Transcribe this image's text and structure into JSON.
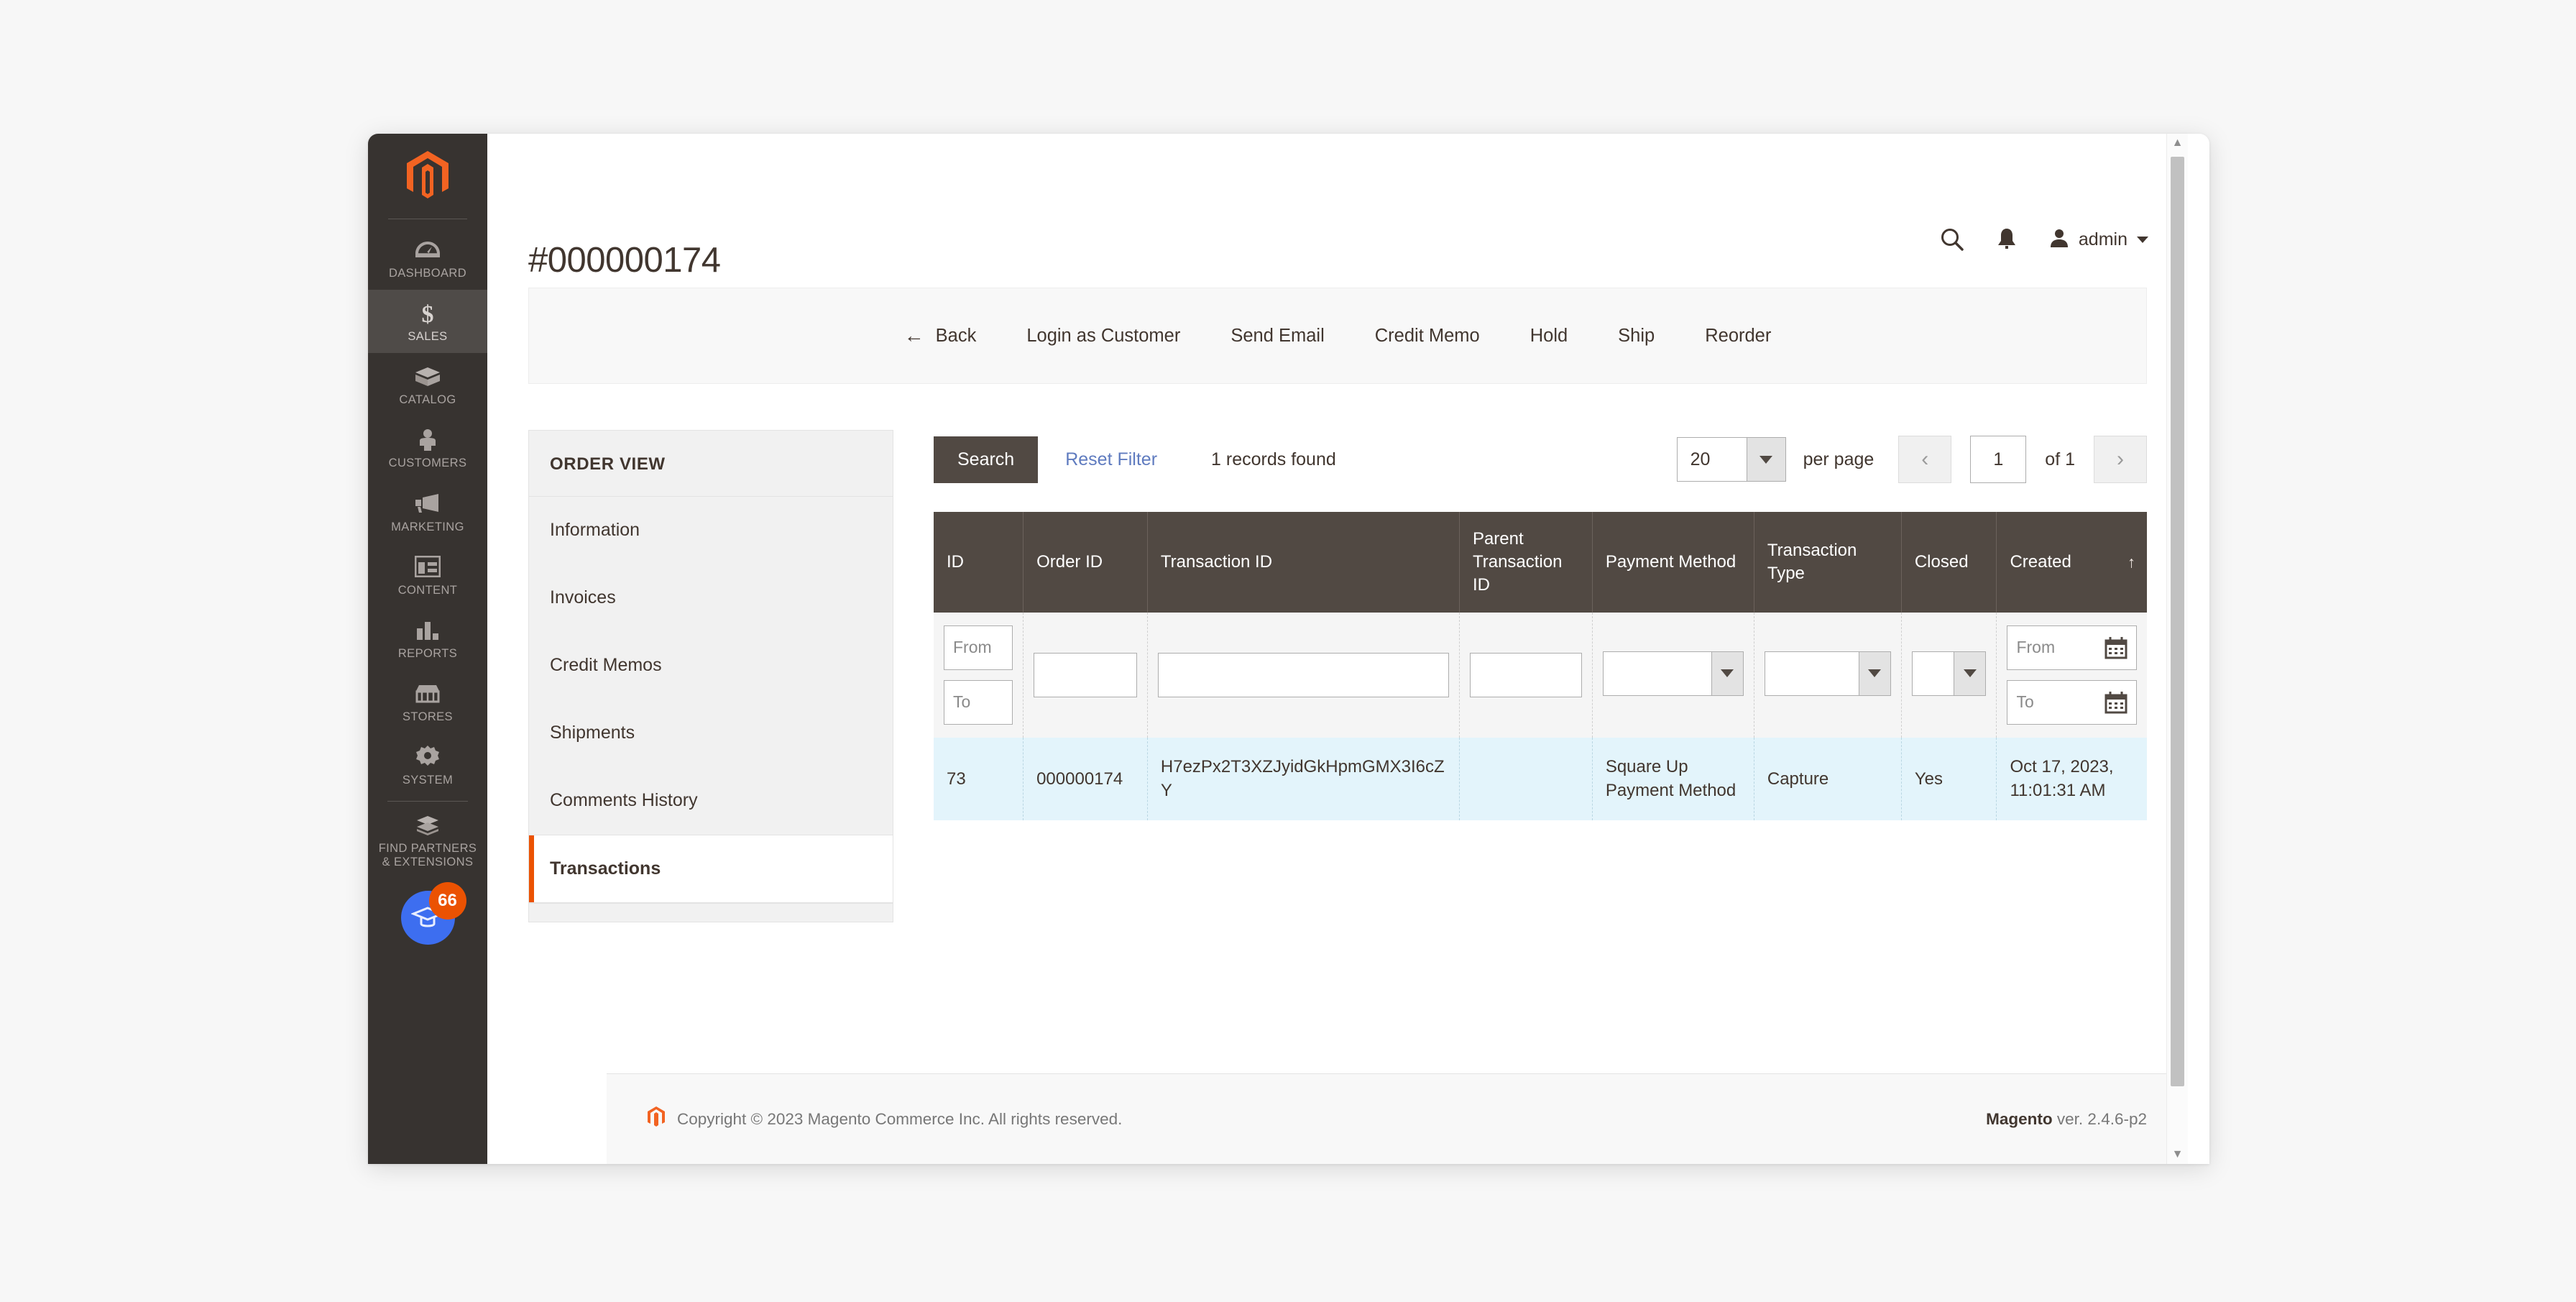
{
  "sidebar": {
    "logo": "magento-logo",
    "items": [
      {
        "label": "DASHBOARD",
        "icon": "gauge-icon",
        "active": false
      },
      {
        "label": "SALES",
        "icon": "dollar-icon",
        "active": true
      },
      {
        "label": "CATALOG",
        "icon": "box-icon",
        "active": false
      },
      {
        "label": "CUSTOMERS",
        "icon": "person-icon",
        "active": false
      },
      {
        "label": "MARKETING",
        "icon": "megaphone-icon",
        "active": false
      },
      {
        "label": "CONTENT",
        "icon": "layout-icon",
        "active": false
      },
      {
        "label": "REPORTS",
        "icon": "bar-chart-icon",
        "active": false
      },
      {
        "label": "STORES",
        "icon": "storefront-icon",
        "active": false
      },
      {
        "label": "SYSTEM",
        "icon": "gear-icon",
        "active": false
      },
      {
        "label": "FIND PARTNERS\n& EXTENSIONS",
        "icon": "extensions-icon",
        "active": false
      }
    ],
    "learn_badge": {
      "icon": "graduation-cap-icon",
      "count": "66",
      "circle_color": "#3d6ef0",
      "badge_color": "#eb5202"
    }
  },
  "header": {
    "page_title": "#000000174",
    "search_icon": "search-icon",
    "notifications_icon": "bell-icon",
    "user_icon": "user-avatar-icon",
    "user_name": "admin"
  },
  "action_toolbar": {
    "back_label": "Back",
    "back_arrow": "←",
    "buttons": [
      "Login as Customer",
      "Send Email",
      "Credit Memo",
      "Hold",
      "Ship",
      "Reorder"
    ]
  },
  "order_view": {
    "title": "ORDER VIEW",
    "items": [
      {
        "label": "Information",
        "current": false
      },
      {
        "label": "Invoices",
        "current": false
      },
      {
        "label": "Credit Memos",
        "current": false
      },
      {
        "label": "Shipments",
        "current": false
      },
      {
        "label": "Comments History",
        "current": false
      },
      {
        "label": "Transactions",
        "current": true
      }
    ],
    "active_accent": "#eb5202"
  },
  "grid_toolbar": {
    "search_label": "Search",
    "reset_filter_label": "Reset Filter",
    "records_found": "1 records found",
    "per_page_value": "20",
    "per_page_label": "per page",
    "prev_glyph": "‹",
    "next_glyph": "›",
    "page_value": "1",
    "of_label": "of 1"
  },
  "grid": {
    "columns": [
      {
        "key": "id",
        "label": "ID",
        "sorted": false
      },
      {
        "key": "order_id",
        "label": "Order ID",
        "sorted": false
      },
      {
        "key": "transaction_id",
        "label": "Transaction ID",
        "sorted": false
      },
      {
        "key": "parent_transaction_id",
        "label": "Parent Transaction ID",
        "sorted": false
      },
      {
        "key": "payment_method",
        "label": "Payment Method",
        "sorted": false
      },
      {
        "key": "transaction_type",
        "label": "Transaction Type",
        "sorted": false
      },
      {
        "key": "closed",
        "label": "Closed",
        "sorted": false
      },
      {
        "key": "created",
        "label": "Created",
        "sorted": true,
        "sort_arrow": "↑"
      }
    ],
    "filters": {
      "id_from_placeholder": "From",
      "id_to_placeholder": "To",
      "order_id_value": "",
      "transaction_id_value": "",
      "parent_transaction_id_value": "",
      "payment_method_value": "",
      "transaction_type_value": "",
      "closed_value": "",
      "created_from_placeholder": "From",
      "created_to_placeholder": "To",
      "calendar_icon": "calendar-icon"
    },
    "rows": [
      {
        "id": "73",
        "order_id": "000000174",
        "transaction_id": "H7ezPx2T3XZJyidGkHpmGMX3I6cZY",
        "parent_transaction_id": "",
        "payment_method": "Square Up Payment Method",
        "transaction_type": "Capture",
        "closed": "Yes",
        "created": "Oct 17, 2023, 11:01:31 AM"
      }
    ],
    "row_highlight_color": "#e3f4fb",
    "header_color": "#514943"
  },
  "footer": {
    "logo": "magento-logo-small",
    "copyright": "Copyright © 2023 Magento Commerce Inc. All rights reserved.",
    "brand": "Magento",
    "version": " ver. 2.4.6-p2"
  },
  "scrollbar": {
    "up_glyph": "▲",
    "down_glyph": "▼"
  }
}
